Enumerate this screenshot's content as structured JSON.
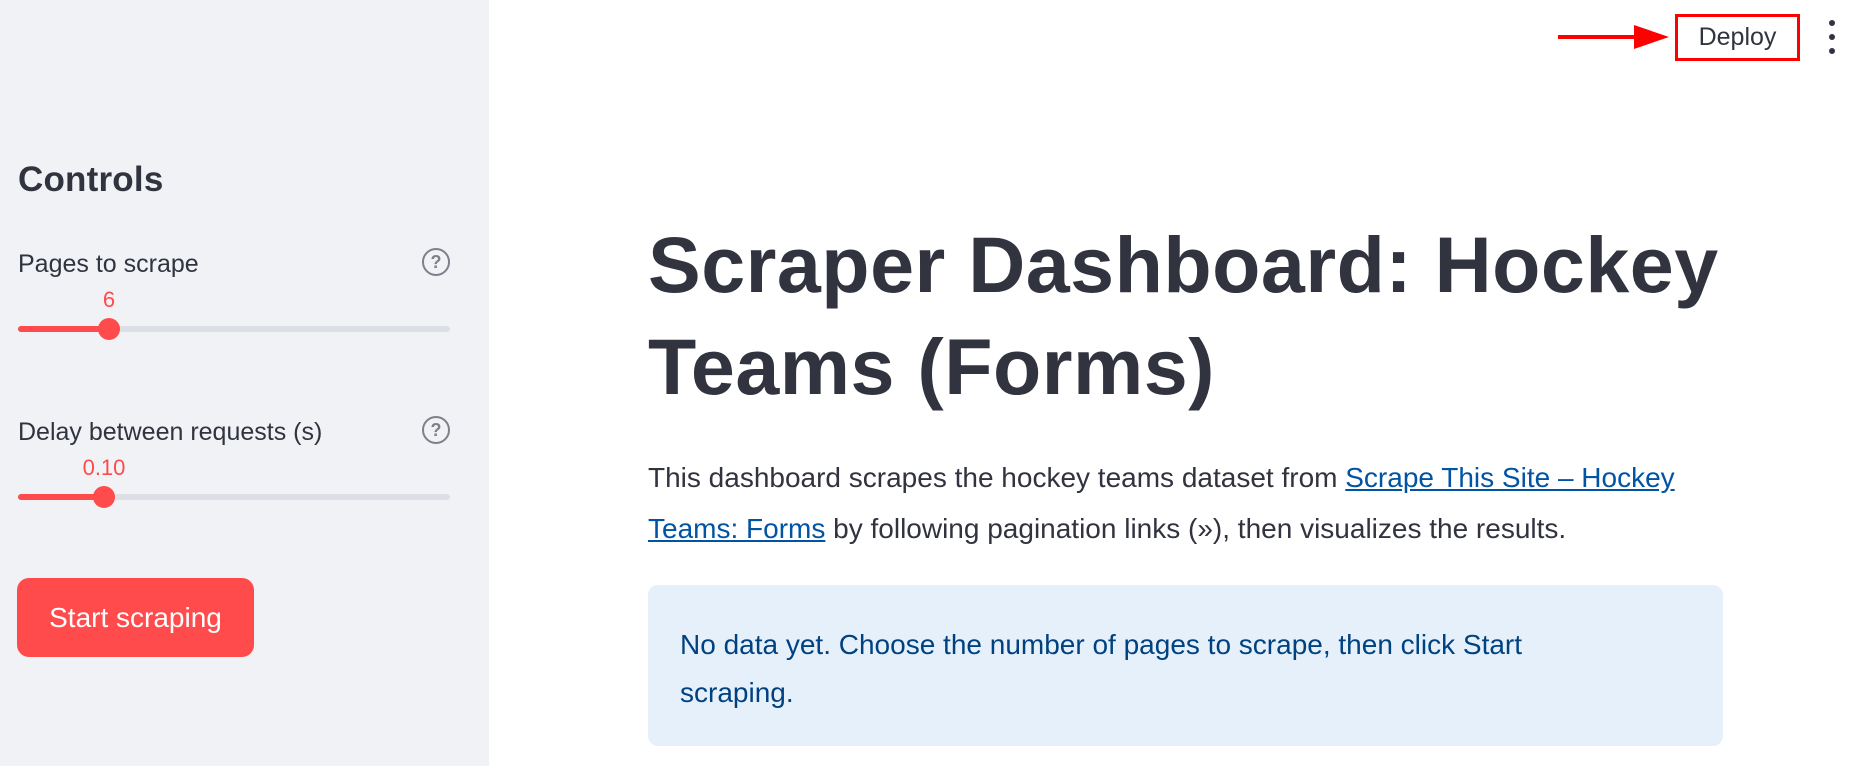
{
  "header": {
    "deploy_label": "Deploy",
    "menu_icon": "vertical-ellipsis-icon",
    "annotation_color": "#ff0000"
  },
  "sidebar": {
    "title": "Controls",
    "sliders": [
      {
        "label": "Pages to scrape",
        "value": "6",
        "fraction": 0.21,
        "help_icon": "question-circle-icon"
      },
      {
        "label": "Delay between requests (s)",
        "value": "0.10",
        "fraction": 0.2,
        "help_icon": "question-circle-icon"
      }
    ],
    "start_button_label": "Start scraping"
  },
  "main": {
    "title": "Scraper Dashboard: Hockey Teams (Forms)",
    "intro_before": "This dashboard scrapes the hockey teams dataset from ",
    "intro_link": "Scrape This Site – Hockey Teams: Forms",
    "intro_after": " by following pagination links (»), then visualizes the results.",
    "info_message": "No data yet. Choose the number of pages to scrape, then click Start scraping."
  },
  "colors": {
    "accent": "#ff4b4b",
    "sidebar_bg": "#f0f2f6",
    "text": "#31333f",
    "link": "#0054a3",
    "info_bg": "#e6f0fb",
    "info_text": "#004280"
  }
}
